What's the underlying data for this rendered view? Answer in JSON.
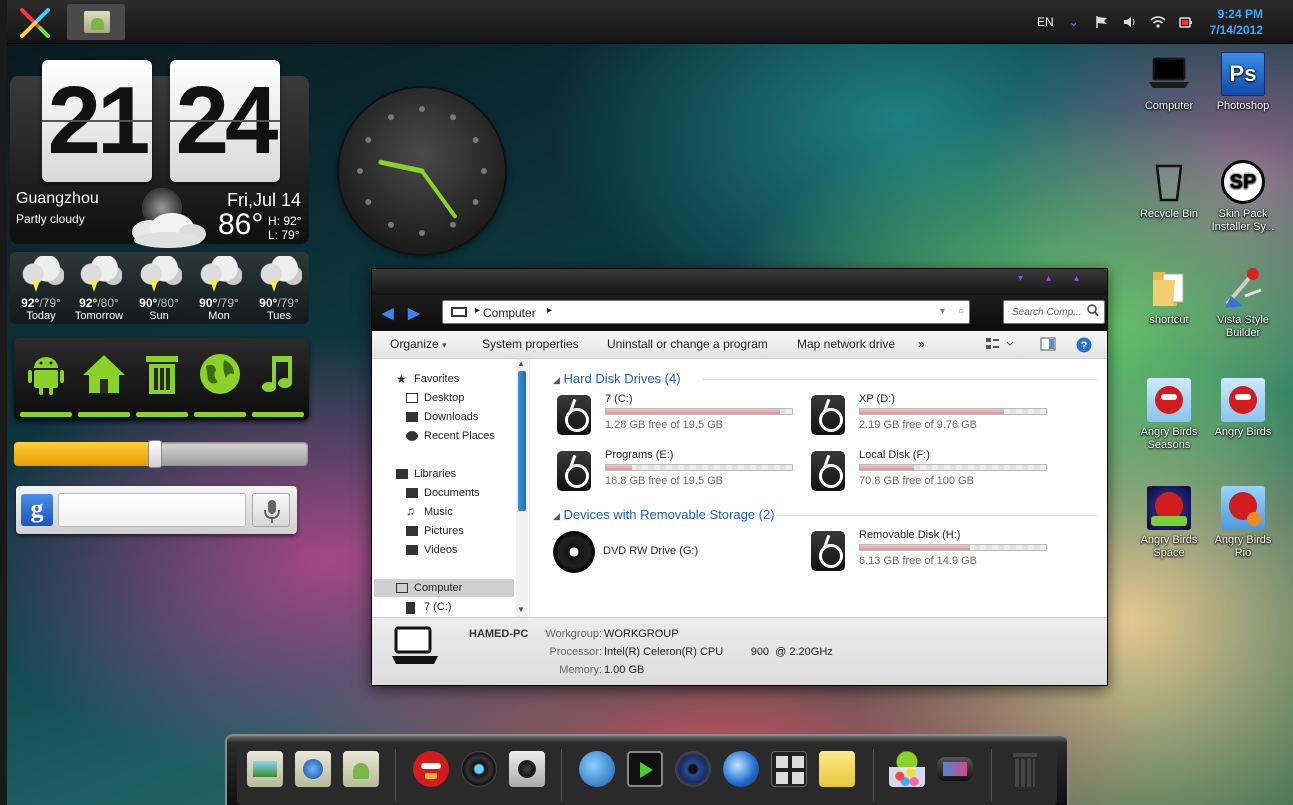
{
  "topbar": {
    "language": "EN",
    "time": "9:24 PM",
    "date": "7/14/2012",
    "accent_color": "#3aa8ff"
  },
  "weather": {
    "hour": "21",
    "minute": "24",
    "city": "Guangzhou",
    "condition": "Partly cloudy",
    "date": "Fri,Jul 14",
    "temperature": "86°",
    "high": "H: 92°",
    "low": "L: 79°",
    "forecast": [
      {
        "hi": "92°",
        "lo": "/79°",
        "day": "Today"
      },
      {
        "hi": "92°",
        "lo": "/80°",
        "day": "Tomorrow"
      },
      {
        "hi": "90°",
        "lo": "/80°",
        "day": "Sun"
      },
      {
        "hi": "90°",
        "lo": "/79°",
        "day": "Mon"
      },
      {
        "hi": "90°",
        "lo": "/79°",
        "day": "Tues"
      }
    ]
  },
  "analog_clock": {
    "hour": 9,
    "minute": 24
  },
  "launcher": {
    "icons": [
      "android-icon",
      "home-icon",
      "trash-icon",
      "globe-icon",
      "music-note-icon"
    ],
    "accent_color": "#8ad12a"
  },
  "volume_slider": {
    "level": 0.48
  },
  "google_search": {
    "logo": "g",
    "placeholder": ""
  },
  "desktop_icons": [
    {
      "label": "Computer",
      "icon": "laptop-icon"
    },
    {
      "label": "Photoshop",
      "icon": "photoshop-icon",
      "badge": "Ps"
    },
    {
      "label": "Recycle Bin",
      "icon": "recycle-bin-icon"
    },
    {
      "label": "Skin Pack Installer Sy...",
      "icon": "skin-pack-icon",
      "badge": "SP"
    },
    {
      "label": "shortcut",
      "icon": "folder-icon"
    },
    {
      "label": "Vista Style Builder",
      "icon": "vista-style-builder-icon"
    },
    {
      "label": "Angry Birds Seasons",
      "icon": "angry-birds-icon"
    },
    {
      "label": "Angry Birds",
      "icon": "angry-birds-icon"
    },
    {
      "label": "Angry Birds Space",
      "icon": "angry-birds-space-icon"
    },
    {
      "label": "Angry Birds Rio",
      "icon": "angry-birds-rio-icon"
    }
  ],
  "explorer": {
    "address": "Computer",
    "search_placeholder": "Search Comp...",
    "toolbar": {
      "organize": "Organize",
      "system_properties": "System properties",
      "uninstall": "Uninstall or change a program",
      "map_drive": "Map network drive",
      "more": "»"
    },
    "nav": {
      "favorites": "Favorites",
      "desktop": "Desktop",
      "downloads": "Downloads",
      "recent": "Recent Places",
      "libraries": "Libraries",
      "documents": "Documents",
      "music": "Music",
      "pictures": "Pictures",
      "videos": "Videos",
      "computer": "Computer",
      "c_drive": "7 (C:)"
    },
    "groups": {
      "hard_disks": "Hard Disk Drives (4)",
      "removable": "Devices with Removable Storage (2)"
    },
    "drives": [
      {
        "name": "7 (C:)",
        "free": "1.28 GB free of 19.5 GB",
        "used": 0.934
      },
      {
        "name": "XP (D:)",
        "free": "2.19 GB free of 9.76 GB",
        "used": 0.776
      },
      {
        "name": "Programs (E:)",
        "free": "16.8 GB free of 19.5 GB",
        "used": 0.138
      },
      {
        "name": "Local Disk (F:)",
        "free": "70.8 GB free of 100 GB",
        "used": 0.292
      }
    ],
    "removable": [
      {
        "name": "DVD RW Drive (G:)"
      },
      {
        "name": "Removable Disk (H:)",
        "free": "6.13 GB free of 14.9 GB",
        "used": 0.589
      }
    ],
    "details": {
      "pc_name": "HAMED-PC",
      "workgroup_label": "Workgroup:",
      "workgroup": "WORKGROUP",
      "processor_label": "Processor:",
      "processor": "Intel(R) Celeron(R) CPU         900  @ 2.20GHz",
      "memory_label": "Memory:",
      "memory": "1.00 GB"
    }
  },
  "dock": {
    "items": [
      "folder-image-icon",
      "folder-globe-icon",
      "folder-android-icon",
      "angry-birds-icon",
      "camera-lens-icon",
      "photo-camera-icon",
      "globe-icon",
      "film-player-icon",
      "speaker-icon",
      "browser-orb-icon",
      "calculator-icon",
      "sticky-notes-icon",
      "jelly-bean-android-icon",
      "gamepad-icon",
      "trash-icon"
    ]
  }
}
